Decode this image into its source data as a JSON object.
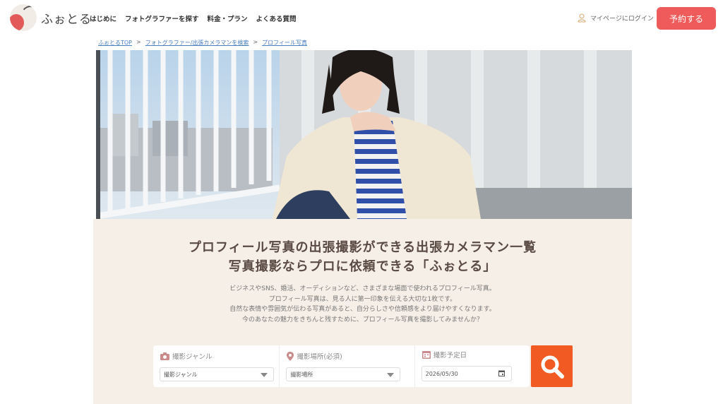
{
  "header": {
    "logo_text": "ふぉとる",
    "nav": [
      "はじめに",
      "フォトグラファーを探す",
      "料金・プラン",
      "よくある質問"
    ],
    "login_label": "マイページにログイン",
    "book_label": "予約する"
  },
  "breadcrumb": {
    "items": [
      "ふぉとるTOP",
      "フォトグラファー/出張カメラマンを検索",
      "プロフィール写真"
    ],
    "separator": ">"
  },
  "intro": {
    "title_line1": "プロフィール写真の出張撮影ができる出張カメラマン一覧",
    "title_line2": "写真撮影ならプロに依頼できる「ふぉとる」",
    "desc": [
      "ビジネスやSNS、婚活、オーディションなど、さまざまな場面で使われるプロフィール写真。",
      "プロフィール写真は、見る人に第一印象を伝える大切な1枚です。",
      "自然な表情や雰囲気が伝わる写真があると、自分らしさや信頼感をより届けやすくなります。",
      "今のあなたの魅力をきちんと残すために、プロフィール写真を撮影してみませんか？"
    ]
  },
  "search": {
    "genre_label": "撮影ジャンル",
    "genre_value": "撮影ジャンル",
    "place_label": "撮影場所(必須)",
    "place_value": "撮影場所",
    "date_label": "撮影予定日",
    "date_value": "2026/05/30"
  },
  "colors": {
    "accent": "#ef5b5b",
    "search_button": "#f25a24",
    "intro_bg": "#f6efe7",
    "link": "#4a7fc1"
  },
  "icons": {
    "user": "user-icon",
    "camera": "camera-icon",
    "pin": "map-pin-icon",
    "calendar": "calendar-icon",
    "search": "search-icon"
  }
}
